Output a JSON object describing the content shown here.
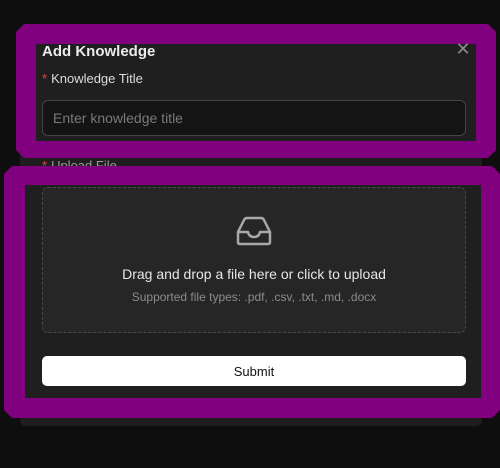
{
  "dialog": {
    "title": "Add Knowledge",
    "close_icon": "close-icon"
  },
  "form": {
    "knowledge_title": {
      "required_mark": "*",
      "label": "Knowledge Title",
      "placeholder": "Enter knowledge title",
      "value": ""
    },
    "upload": {
      "required_mark": "*",
      "label": "Upload File",
      "icon": "inbox-icon",
      "prompt": "Drag and drop a file here or click to upload",
      "hint": "Supported file types: .pdf, .csv, .txt, .md, .docx"
    },
    "submit_label": "Submit"
  },
  "colors": {
    "highlight_frame": "#800080",
    "required": "#e0484a",
    "submit_bg": "#ffffff"
  }
}
